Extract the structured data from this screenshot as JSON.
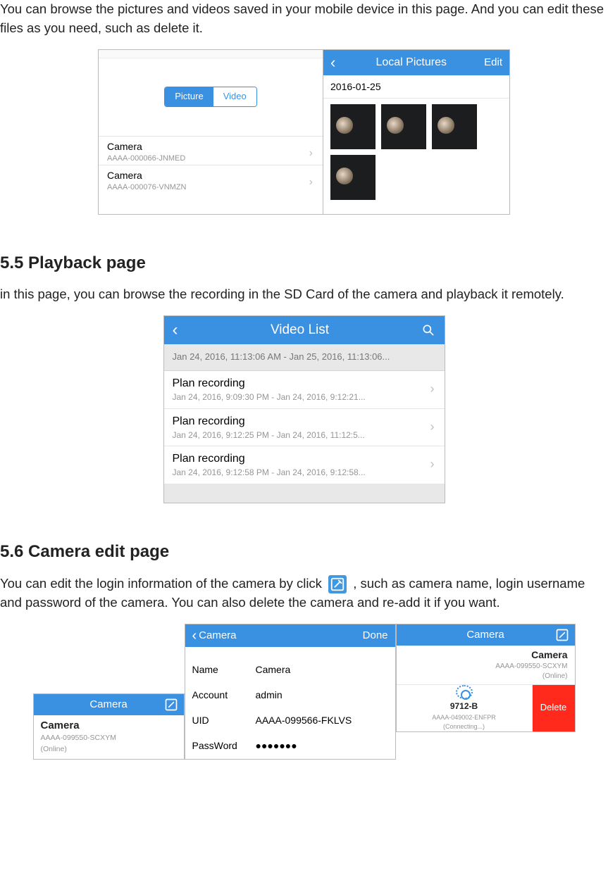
{
  "intro_text": "You can browse the pictures and videos saved in your mobile device in this page. And you can edit these files as you need, such as delete it.",
  "fig1": {
    "left": {
      "seg_picture_label": "Picture",
      "seg_video_label": "Video",
      "cameras": [
        {
          "name": "Camera",
          "uid": "AAAA-000066-JNMED"
        },
        {
          "name": "Camera",
          "uid": "AAAA-000076-VNMZN"
        }
      ]
    },
    "right": {
      "nav_title": "Local Pictures",
      "nav_edit": "Edit",
      "date_header": "2016-01-25"
    }
  },
  "section_55_heading": "5.5 Playback page",
  "section_55_text": "in this page, you can browse the recording in the SD Card of the camera and playback it remotely.",
  "fig2": {
    "nav_title": "Video List",
    "date_header": "Jan 24, 2016, 11:13:06 AM - Jan 25, 2016, 11:13:06...",
    "recordings": [
      {
        "title": "Plan recording",
        "sub": "Jan 24, 2016, 9:09:30 PM - Jan 24, 2016, 9:12:21..."
      },
      {
        "title": "Plan recording",
        "sub": "Jan 24, 2016, 9:12:25 PM - Jan 24, 2016, 11:12:5..."
      },
      {
        "title": "Plan recording",
        "sub": "Jan 24, 2016, 9:12:58 PM - Jan 24, 2016, 9:12:58..."
      }
    ]
  },
  "section_56_heading": "5.6 Camera edit page",
  "section_56_text_before_icon": "You can edit the login information of the camera by click ",
  "section_56_text_after_icon": ", such as camera name, login username and password of the camera. You can also delete the camera and re-add it if you want.",
  "fig3": {
    "card_a": {
      "nav_title": "Camera",
      "name": "Camera",
      "uid": "AAAA-099550-SCXYM",
      "status": "(Online)"
    },
    "form": {
      "nav_back_label": "Camera",
      "nav_done_label": "Done",
      "rows": {
        "name_lbl": "Name",
        "name_val": "Camera",
        "account_lbl": "Account",
        "account_val": "admin",
        "uid_lbl": "UID",
        "uid_val": "AAAA-099566-FKLVS",
        "pwd_lbl": "PassWord",
        "pwd_val": "●●●●●●●"
      }
    },
    "card_c": {
      "nav_title": "Camera",
      "top": {
        "name": "Camera",
        "uid": "AAAA-099550-SCXYM",
        "status": "(Online)"
      },
      "swiped": {
        "name": "9712-B",
        "uid": "AAAA-049002-ENFPR",
        "status": "(Connecting...)"
      },
      "delete_label": "Delete"
    }
  }
}
